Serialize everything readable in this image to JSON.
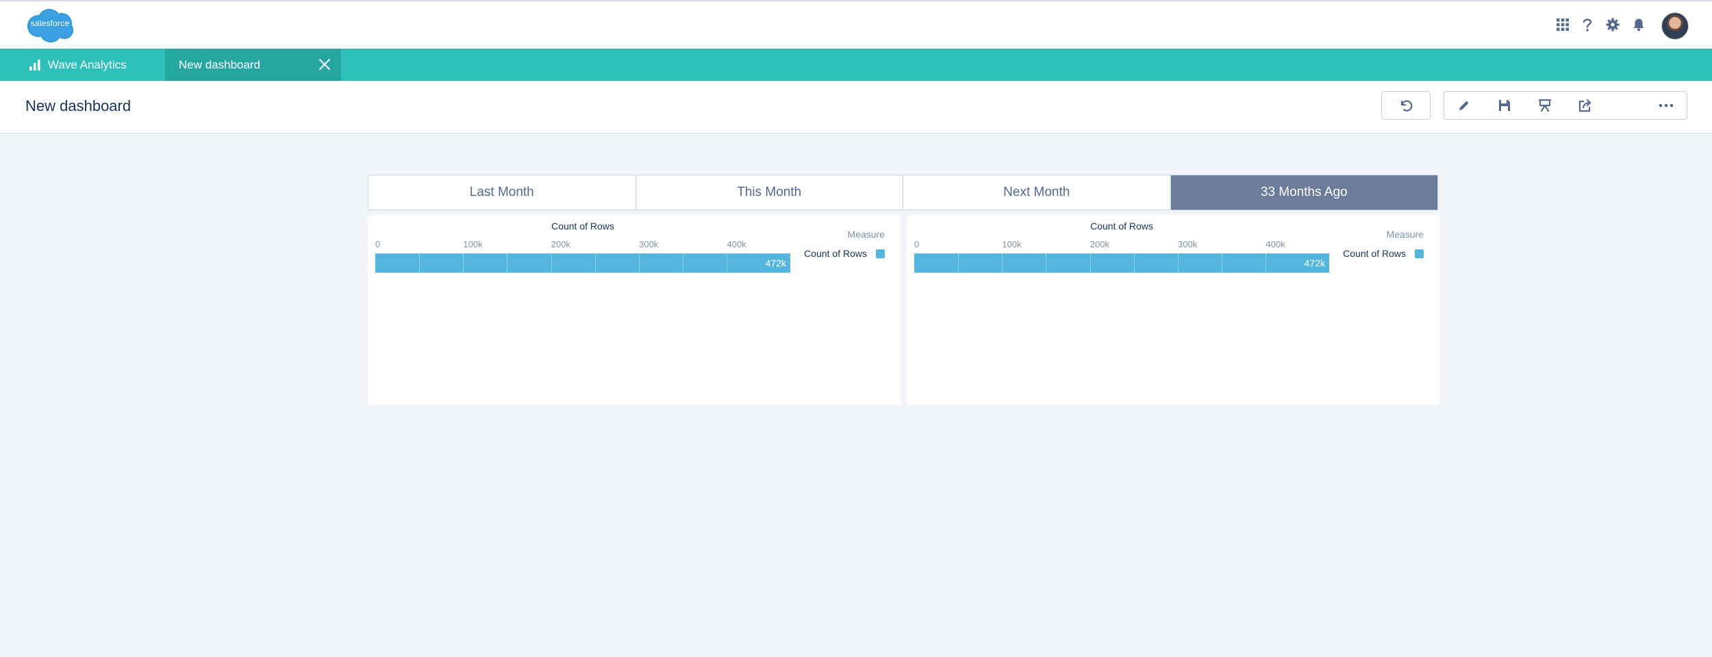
{
  "global_header": {
    "logo_text": "salesforce",
    "utility_icons": [
      "app-launcher-icon",
      "help-icon",
      "setup-gear-icon",
      "notifications-bell-icon"
    ]
  },
  "tabs": {
    "app_name": "Wave Analytics",
    "active_tab": "New dashboard"
  },
  "page": {
    "title": "New dashboard",
    "toolbar_icons": [
      "undo-icon",
      "edit-pencil-icon",
      "save-icon",
      "present-icon",
      "share-icon",
      "blank",
      "more-icon"
    ]
  },
  "date_filter": {
    "options": [
      "Last Month",
      "This Month",
      "Next Month",
      "33 Months Ago"
    ],
    "selected": "33 Months Ago"
  },
  "chart_data": [
    {
      "type": "bar",
      "title": "Count of Rows",
      "xlabel": "",
      "ylabel": "",
      "x_ticks": [
        "0",
        "100k",
        "200k",
        "300k",
        "400k"
      ],
      "xlim": [
        0,
        472000
      ],
      "categories": [
        ""
      ],
      "series": [
        {
          "name": "Count of Rows",
          "values": [
            472000
          ]
        }
      ],
      "data_labels": [
        "472k"
      ],
      "legend": {
        "title": "Measure",
        "placement": "right"
      },
      "colors": {
        "bar": "#54b6df"
      }
    },
    {
      "type": "bar",
      "title": "Count of Rows",
      "xlabel": "",
      "ylabel": "",
      "x_ticks": [
        "0",
        "100k",
        "200k",
        "300k",
        "400k"
      ],
      "xlim": [
        0,
        472000
      ],
      "categories": [
        ""
      ],
      "series": [
        {
          "name": "Count of Rows",
          "values": [
            472000
          ]
        }
      ],
      "data_labels": [
        "472k"
      ],
      "legend": {
        "title": "Measure",
        "placement": "right"
      },
      "colors": {
        "bar": "#54b6df"
      }
    }
  ],
  "colors": {
    "brand_teal": "#2ec0ba",
    "active_tab_teal": "#26a6a1",
    "selected_segment": "#6b7c9a",
    "text_dark": "#16325c",
    "text_muted": "#8192ad"
  }
}
